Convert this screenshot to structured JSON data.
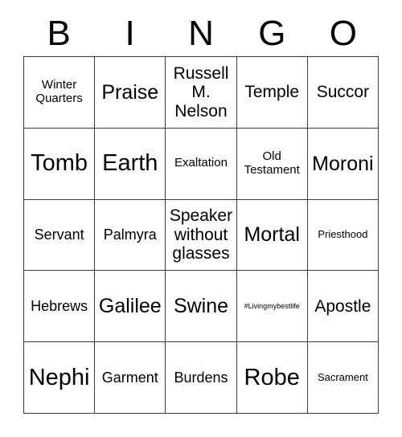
{
  "card": {
    "header_letters": [
      "B",
      "I",
      "N",
      "G",
      "O"
    ],
    "rows": [
      [
        {
          "text": "Winter Quarters",
          "size": "sm"
        },
        {
          "text": "Praise",
          "size": "xl"
        },
        {
          "text": "Russell M. Nelson",
          "size": "lg"
        },
        {
          "text": "Temple",
          "size": "lg"
        },
        {
          "text": "Succor",
          "size": "lg"
        }
      ],
      [
        {
          "text": "Tomb",
          "size": "xxl"
        },
        {
          "text": "Earth",
          "size": "xxl"
        },
        {
          "text": "Exaltation",
          "size": "sm"
        },
        {
          "text": "Old Testament",
          "size": "sm"
        },
        {
          "text": "Moroni",
          "size": "xl"
        }
      ],
      [
        {
          "text": "Servant",
          "size": "md"
        },
        {
          "text": "Palmyra",
          "size": "md"
        },
        {
          "text": "Speaker without glasses",
          "size": "lg"
        },
        {
          "text": "Mortal",
          "size": "xl"
        },
        {
          "text": "Priesthood",
          "size": "xs"
        }
      ],
      [
        {
          "text": "Hebrews",
          "size": "md"
        },
        {
          "text": "Galilee",
          "size": "xl"
        },
        {
          "text": "Swine",
          "size": "xl"
        },
        {
          "text": "#Livingmybestlife",
          "size": "xxs"
        },
        {
          "text": "Apostle",
          "size": "lg"
        }
      ],
      [
        {
          "text": "Nephi",
          "size": "xxl"
        },
        {
          "text": "Garment",
          "size": "md"
        },
        {
          "text": "Burdens",
          "size": "md"
        },
        {
          "text": "Robe",
          "size": "xxl"
        },
        {
          "text": "Sacrament",
          "size": "xs"
        }
      ]
    ]
  },
  "colors": {
    "background": "#ffffff",
    "text": "#000000",
    "grid_line": "#3a3a3a"
  }
}
